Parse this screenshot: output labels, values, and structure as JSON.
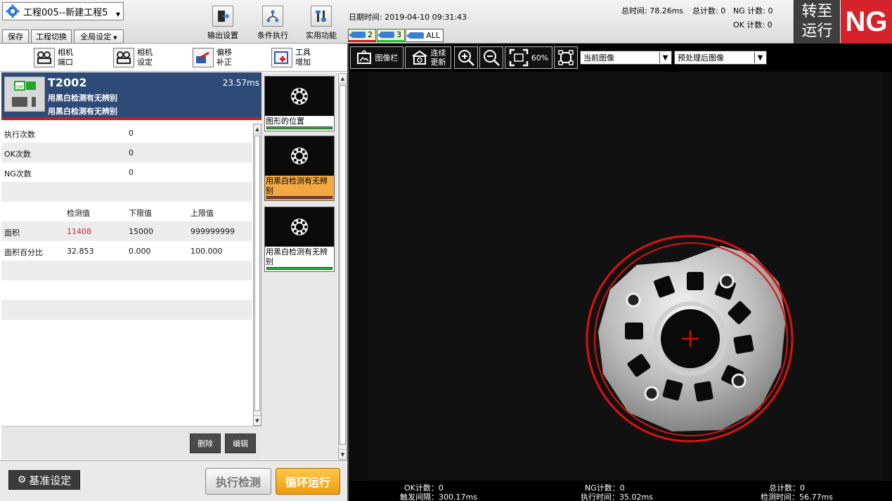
{
  "topbar": {
    "project": "工程005--新建工程5",
    "buttons": {
      "save": "保存",
      "switch": "工程切换",
      "global": "全局设定"
    },
    "tools": {
      "output": "输出设置",
      "condition": "条件执行",
      "utility": "实用功能"
    },
    "datetime": "日期时间: 2019-04-10 09:31:43",
    "cams": [
      "2",
      "3",
      "ALL"
    ],
    "stats": {
      "total_time": "总时间: 78.26ms",
      "total_count": "总计数: 0",
      "ng_count": "NG 计数: 0",
      "ok_count": "OK 计数: 0"
    },
    "run": {
      "line1": "转至",
      "line2": "运行"
    },
    "ng": "NG"
  },
  "camera_tools": [
    {
      "l1": "相机",
      "l2": "端口"
    },
    {
      "l1": "相机",
      "l2": "设定"
    },
    {
      "l1": "偏移",
      "l2": "补正"
    },
    {
      "l1": "工具",
      "l2": "增加"
    }
  ],
  "tool": {
    "id": "T2002",
    "time": "23.57ms",
    "desc1": "用黑白检测有无辨别",
    "desc2": "用黑白检测有无辨别"
  },
  "params": {
    "exec_label": "执行次数",
    "exec_value": "0",
    "ok_label": "OK次数",
    "ok_value": "0",
    "ng_label": "NG次数",
    "ng_value": "0",
    "col_measured": "检测值",
    "col_lower": "下限值",
    "col_upper": "上限值",
    "rows": [
      {
        "name": "面积",
        "measured": "11408",
        "lower": "15000",
        "upper": "999999999"
      },
      {
        "name": "面积百分比",
        "measured": "32.853",
        "lower": "0.000",
        "upper": "100.000"
      }
    ],
    "delete": "删除",
    "edit": "编辑"
  },
  "tool_list": [
    {
      "label": "图形的位置",
      "status_color": "#22c02c"
    },
    {
      "label": "用黑白检测有无辨别",
      "status_color": "#d71a1a"
    },
    {
      "label": "用黑白检测有无辨别",
      "status_color": "#22c02c"
    }
  ],
  "bottom": {
    "base": "基准设定",
    "exec": "执行检测",
    "loop": "循环运行"
  },
  "viewer": {
    "image_bar": "图像栏",
    "continuous_l1": "连续",
    "continuous_l2": "更新",
    "zoom": "60%",
    "select_current": "当前图像",
    "select_processed": "预处理后图像"
  },
  "viewer_footer": {
    "ok": "OK计数：0",
    "interval": "触发间隔：300.17ms",
    "ng": "NG计数：0",
    "exec_time": "执行时间：35.02ms",
    "total": "总计数：0",
    "detect_time": "检测时间：56.77ms"
  },
  "colors": {
    "ng_red": "#d6222a",
    "header_blue": "#2e4a77",
    "loop_orange": "#f5a623",
    "measured_fail": "#e02020"
  }
}
